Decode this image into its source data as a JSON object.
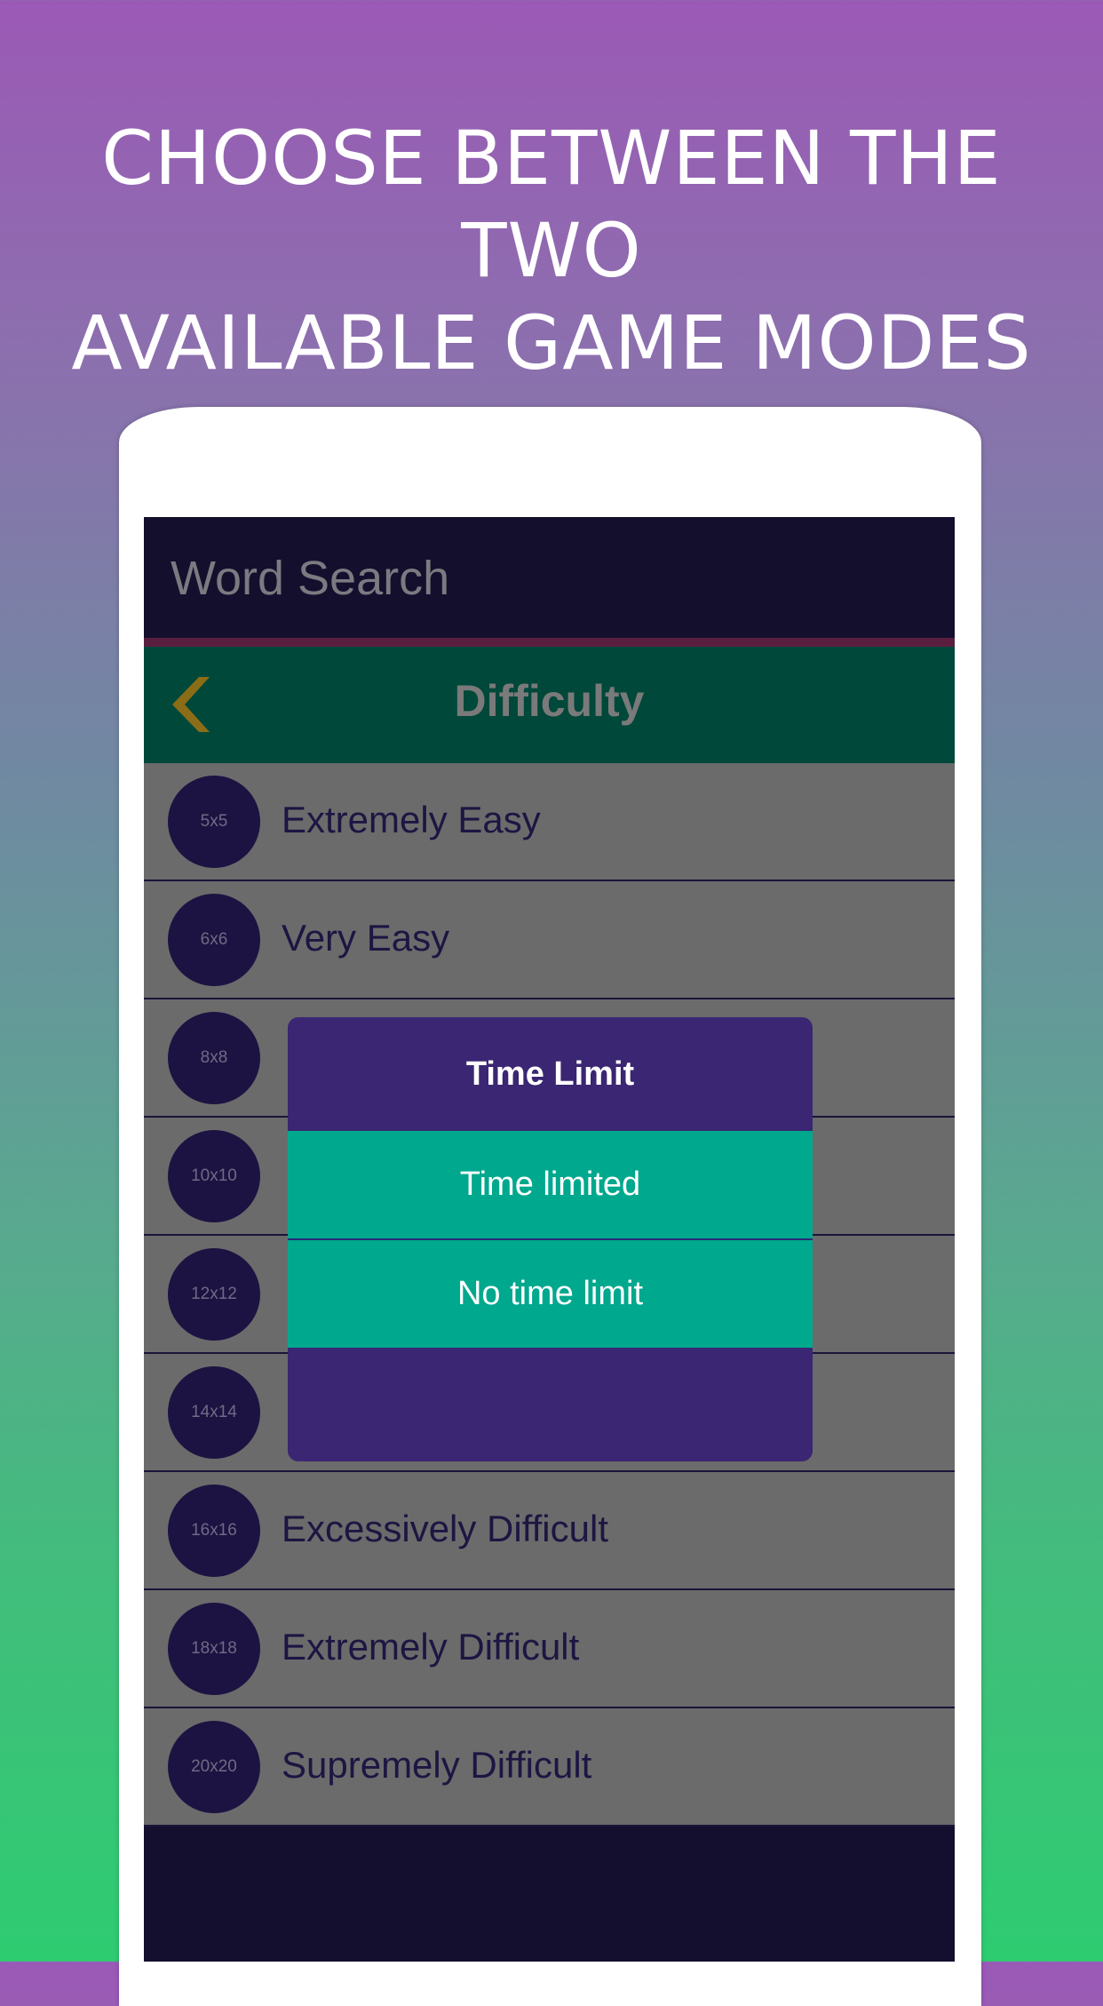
{
  "headline": {
    "line1": "CHOOSE BETWEEN THE TWO",
    "line2": "AVAILABLE GAME MODES"
  },
  "app": {
    "title": "Word Search",
    "screen_title": "Difficulty",
    "back_icon": "chevron-left-icon"
  },
  "difficulty_list": [
    {
      "size": "5x5",
      "label": "Extremely Easy"
    },
    {
      "size": "6x6",
      "label": "Very Easy"
    },
    {
      "size": "8x8",
      "label": ""
    },
    {
      "size": "10x10",
      "label": ""
    },
    {
      "size": "12x12",
      "label": ""
    },
    {
      "size": "14x14",
      "label": ""
    },
    {
      "size": "16x16",
      "label": "Excessively Difficult"
    },
    {
      "size": "18x18",
      "label": "Extremely Difficult"
    },
    {
      "size": "20x20",
      "label": "Supremely Difficult"
    }
  ],
  "dialog": {
    "title": "Time Limit",
    "options": [
      "Time limited",
      "No time limit"
    ]
  },
  "colors": {
    "dialog": "#3a2672",
    "option": "#00a88d",
    "back_icon": "#8a6d16"
  }
}
